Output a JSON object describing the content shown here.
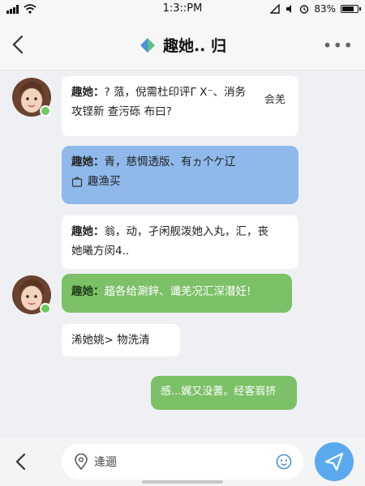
{
  "status": {
    "time": "1:3::PM",
    "battery": "83%",
    "battery_level": 0.83
  },
  "header": {
    "title": "趣她.. 归",
    "back_icon": "chevron-left-icon",
    "more_icon": "more-icon",
    "title_icon": "diamond-logo-icon"
  },
  "messages": [
    {
      "type": "received",
      "style": "white",
      "name": "趣她：",
      "text": "? 蒎，倪需杜印评Γ X⁻、消务",
      "text2": "攻铿新 查污砾 布曰?",
      "side_note": "会羌"
    },
    {
      "type": "sent",
      "style": "blue",
      "name": "趣她：",
      "text": "青，慈惆透版、有ヵ个ケ辽",
      "sub_label": "趣渔买"
    },
    {
      "type": "received",
      "style": "white",
      "name": "趣她：",
      "text": "翁，动，孑闲舰泼她入丸，汇，丧",
      "text2": "她曦方闵4.."
    },
    {
      "type": "received",
      "style": "green",
      "name": "趣她：",
      "text": "趦各给涮鋅、谶羌况汇深潜妊!"
    },
    {
      "type": "received",
      "style": "white",
      "text": "浠她姚> 物洗清"
    },
    {
      "type": "sent",
      "style": "green",
      "text": "感...娓又没蓍。经客嵡挤"
    }
  ],
  "input": {
    "text": "逄逦",
    "back_icon": "chevron-left-icon",
    "location_icon": "location-pin-icon",
    "emoji_icon": "emoji-icon",
    "send_icon": "send-icon"
  },
  "colors": {
    "blue_bubble": "#8fb9ea",
    "green_bubble": "#7cc067",
    "send_button": "#5aa9ef",
    "online": "#6cc95e"
  }
}
